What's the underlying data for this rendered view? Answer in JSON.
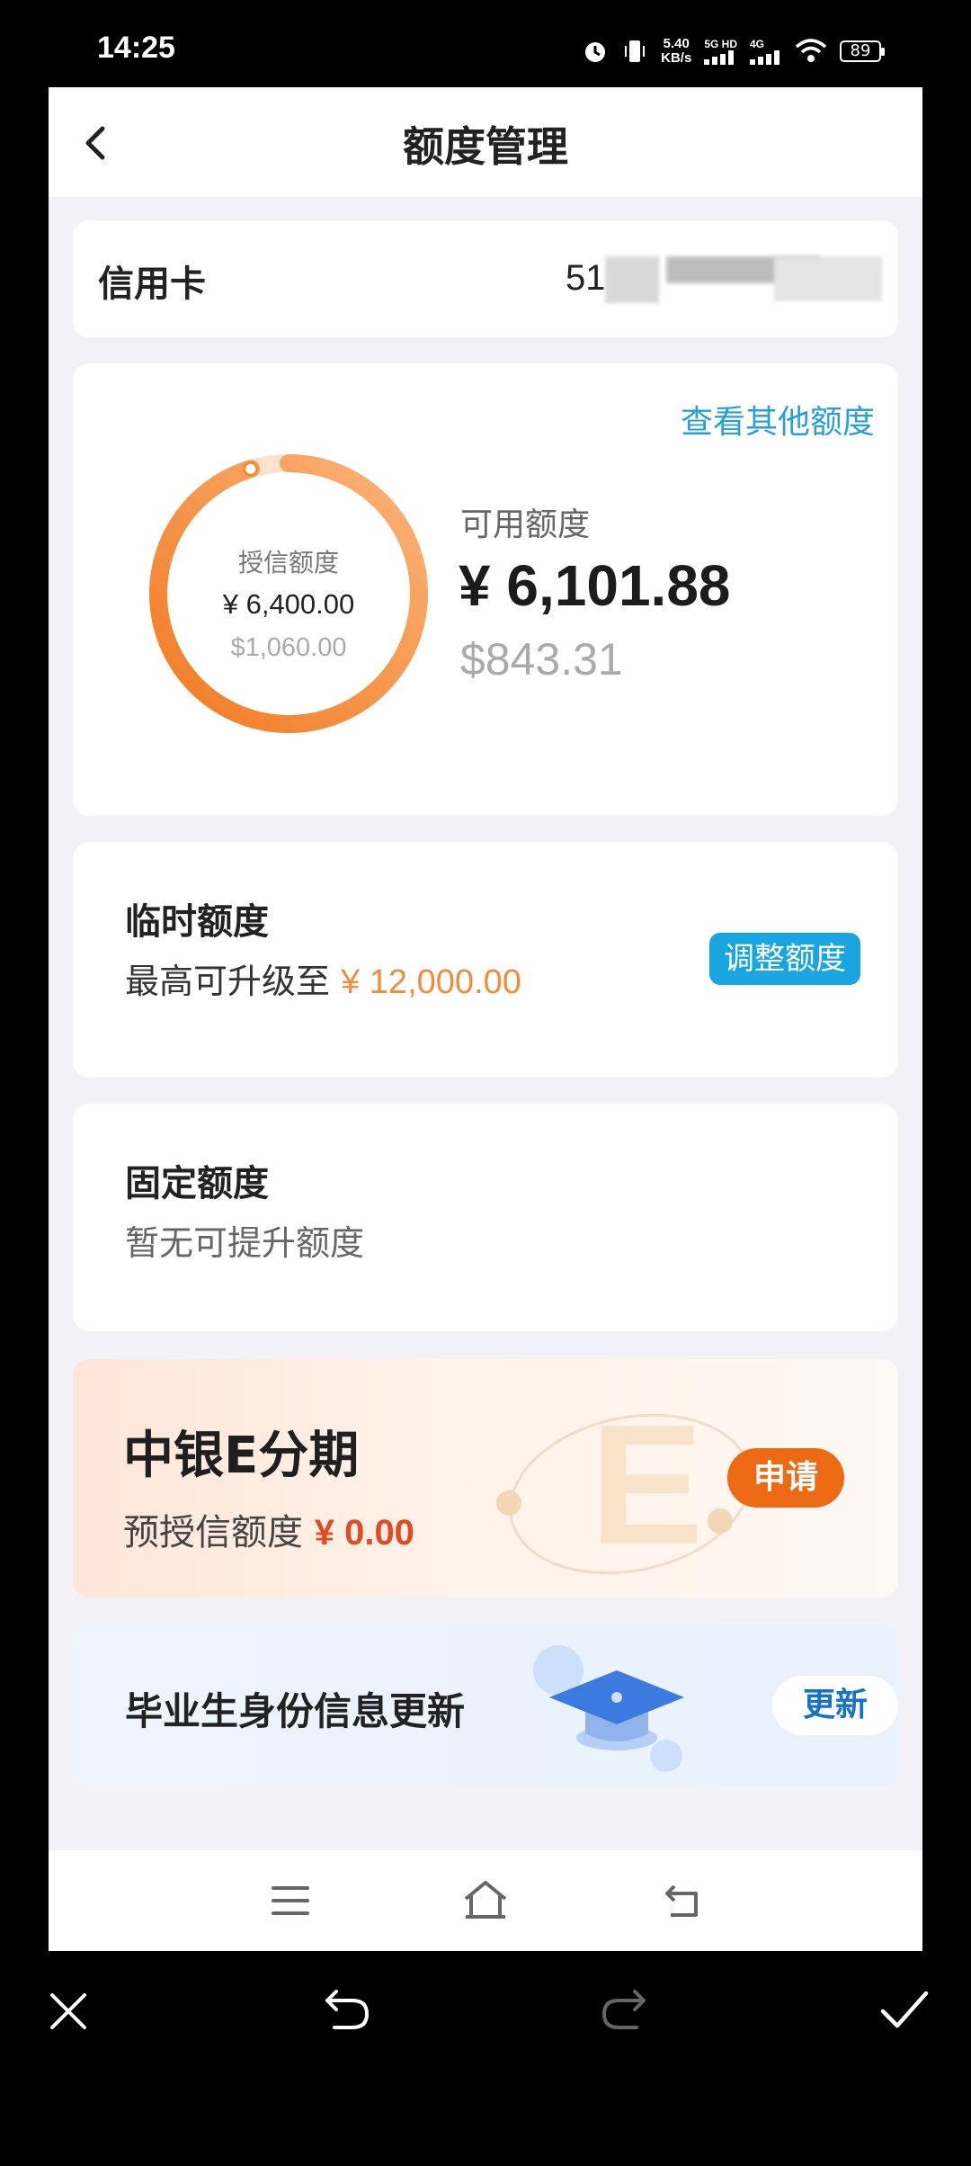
{
  "status": {
    "time": "14:25",
    "speed_value": "5.40",
    "speed_unit": "KB/s",
    "net1": "5G HD",
    "net2": "4G",
    "battery": "89"
  },
  "header": {
    "title": "额度管理"
  },
  "card_info": {
    "label": "信用卡",
    "number_prefix": "51"
  },
  "summary": {
    "link": "查看其他额度",
    "ring_label": "授信额度",
    "credit_cny": "¥ 6,400.00",
    "credit_usd": "$1,060.00",
    "available_label": "可用额度",
    "available_cny": "¥ 6,101.88",
    "available_usd": "$843.31",
    "available_fraction": 0.953
  },
  "temp_limit": {
    "title": "临时额度",
    "desc": "最高可升级至",
    "amount": "¥ 12,000.00",
    "button": "调整额度"
  },
  "fixed_limit": {
    "title": "固定额度",
    "desc": "暂无可提升额度"
  },
  "promo_e": {
    "title": "中银E分期",
    "desc": "预授信额度",
    "amount": "¥ 0.00",
    "button": "申请"
  },
  "graduate": {
    "title": "毕业生身份信息更新",
    "button": "更新"
  },
  "colors": {
    "accent_blue": "#19a6e0",
    "accent_orange": "#ec6a14",
    "ring_orange": "#f5892e"
  }
}
